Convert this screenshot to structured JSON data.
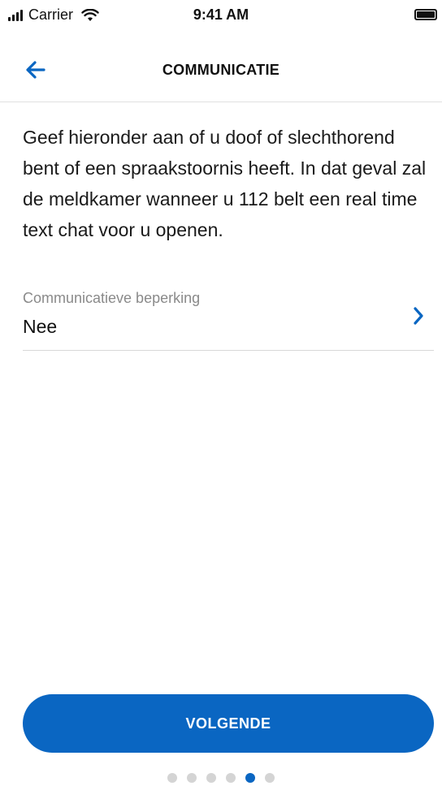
{
  "status_bar": {
    "carrier": "Carrier",
    "time": "9:41 AM"
  },
  "nav": {
    "title": "COMMUNICATIE",
    "back_icon": "arrow-left-icon"
  },
  "content": {
    "description": "Geef hieronder aan of u doof of slechthorend bent of een spraakstoornis heeft. In dat geval zal de meldkamer wanneer u 112 belt een real time text chat voor u openen.",
    "field": {
      "label": "Communicatieve beperking",
      "value": "Nee",
      "icon": "chevron-right-icon"
    }
  },
  "footer": {
    "next_label": "VOLGENDE",
    "pagination": {
      "total": 6,
      "current": 5
    }
  },
  "colors": {
    "accent": "#0a66c2",
    "text": "#111111",
    "muted": "#8a8a8a",
    "divider": "#d8d8d8",
    "dot_inactive": "#d4d4d4"
  }
}
